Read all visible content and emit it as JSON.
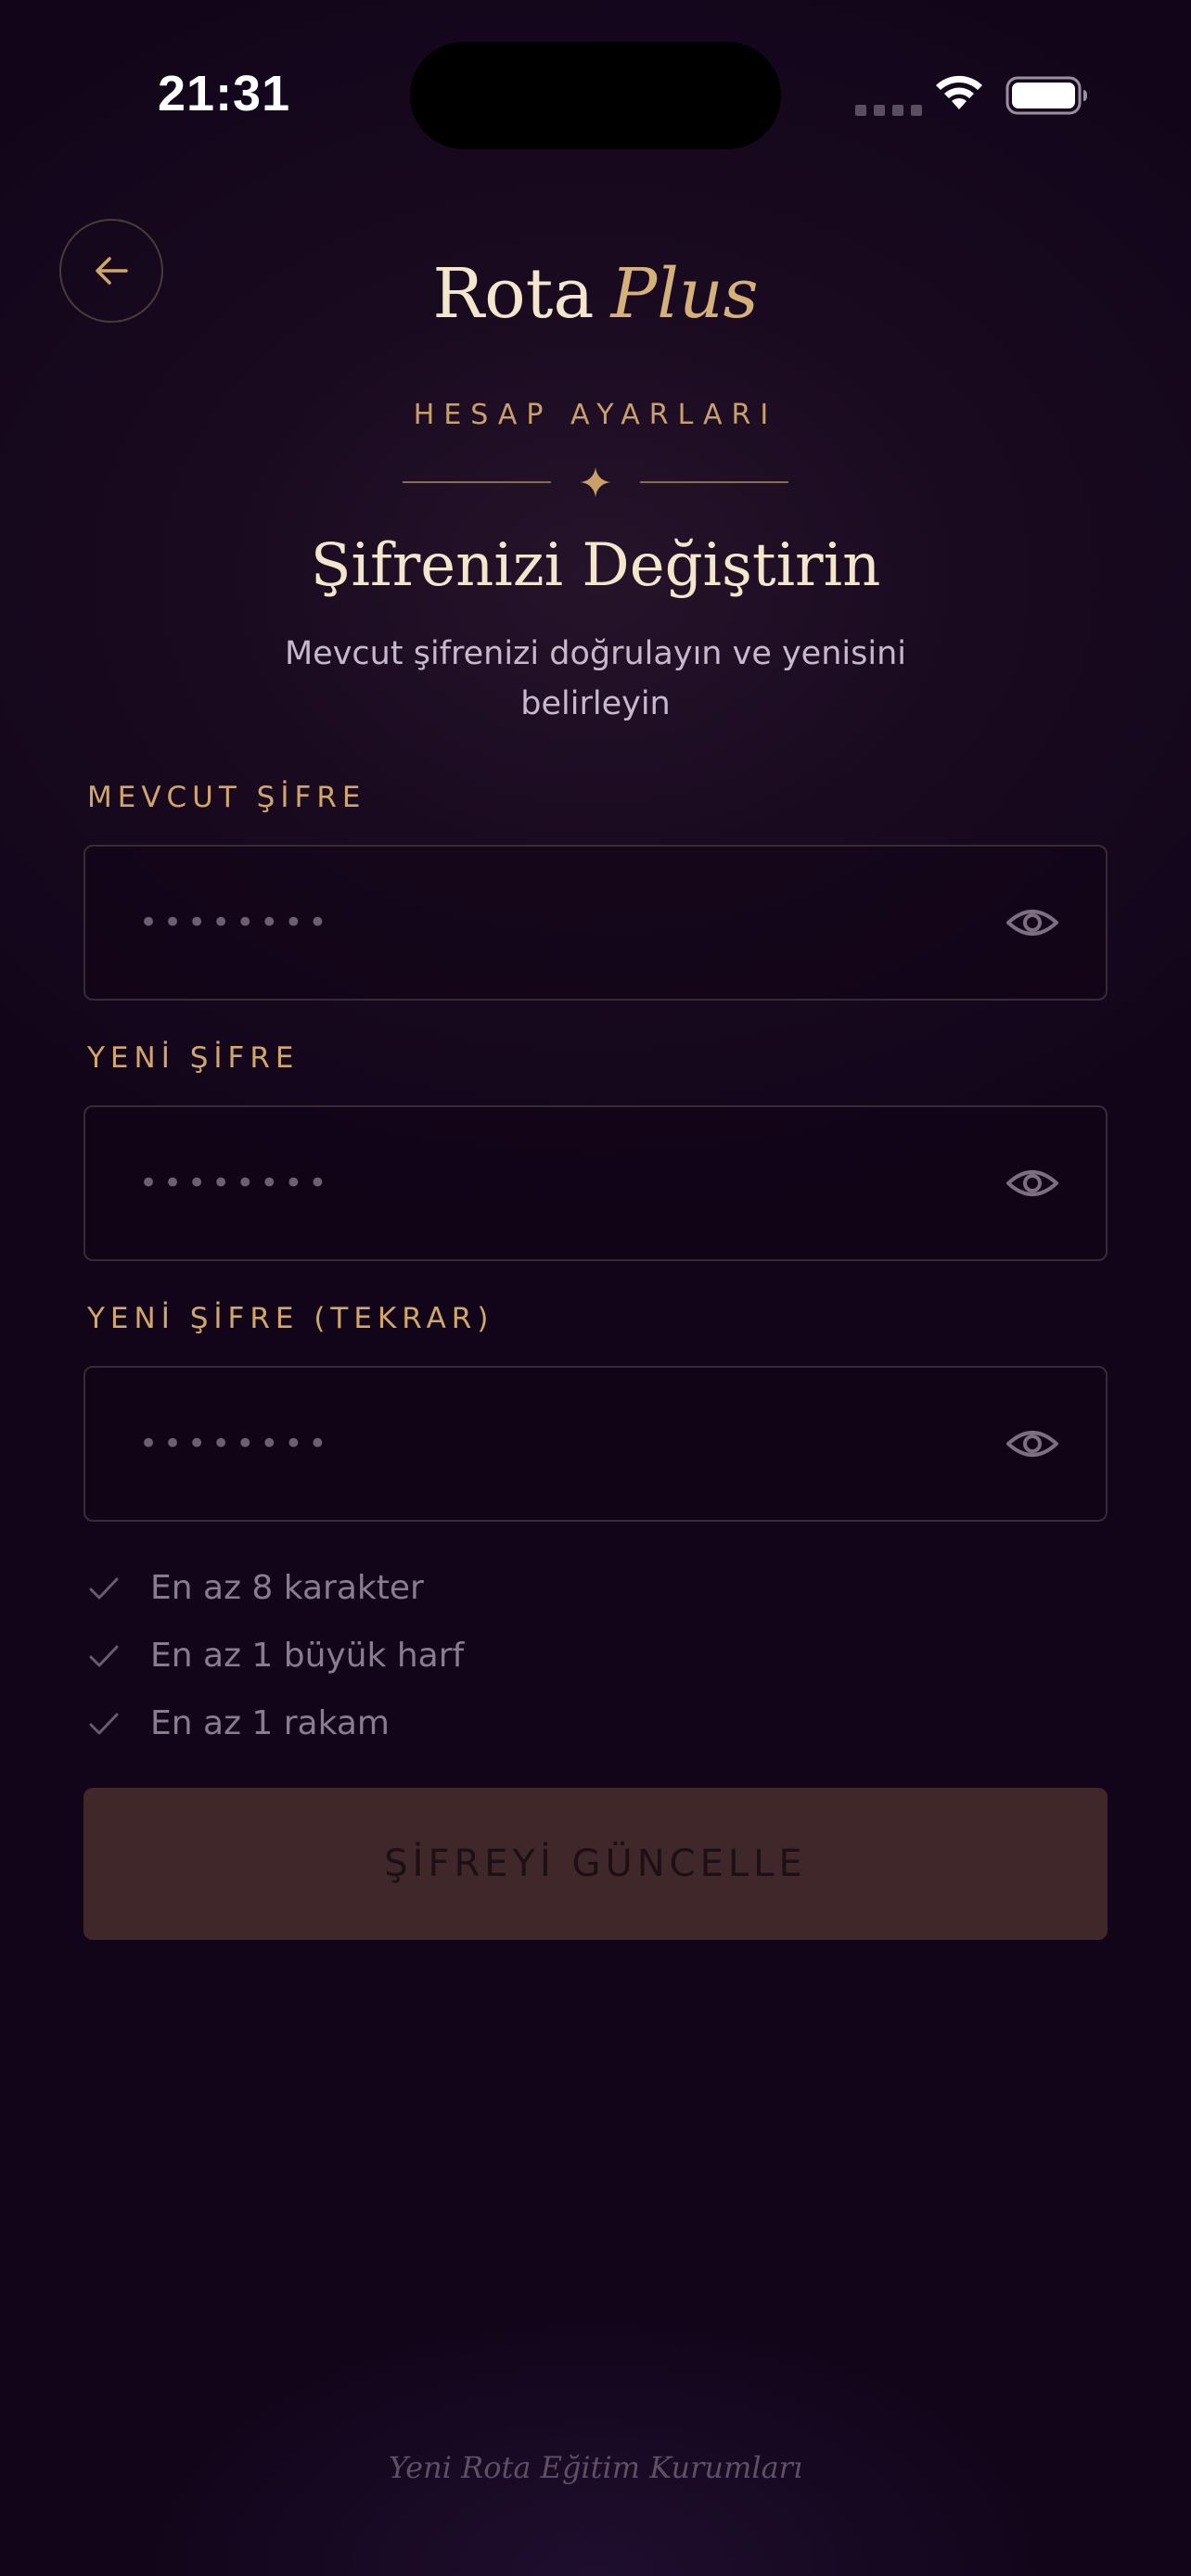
{
  "status_bar": {
    "time": "21:31"
  },
  "header": {
    "logo_main": "Rota",
    "logo_accent": "Plus",
    "eyebrow": "HESAP AYARLARI",
    "title": "Şifrenizi Değiştirin",
    "subtitle": "Mevcut şifrenizi doğrulayın ve yenisini belirleyin"
  },
  "form": {
    "fields": [
      {
        "label": "MEVCUT ŞİFRE",
        "value": "••••••••"
      },
      {
        "label": "YENİ ŞİFRE",
        "value": "••••••••"
      },
      {
        "label": "YENİ ŞİFRE (TEKRAR)",
        "value": "••••••••"
      }
    ],
    "requirements": [
      "En az 8 karakter",
      "En az 1 büyük harf",
      "En az 1 rakam"
    ],
    "submit_label": "ŞİFREYİ GÜNCELLE"
  },
  "footer": {
    "text": "Yeni Rota Eğitim Kurumları"
  },
  "icons": {
    "back": "arrow-left-icon",
    "visibility": "eye-icon",
    "check": "check-icon",
    "ornament": "sparkle-icon"
  },
  "colors": {
    "accent": "#d1a66b",
    "background": "#1a0a20",
    "button_disabled": "#40282a"
  }
}
